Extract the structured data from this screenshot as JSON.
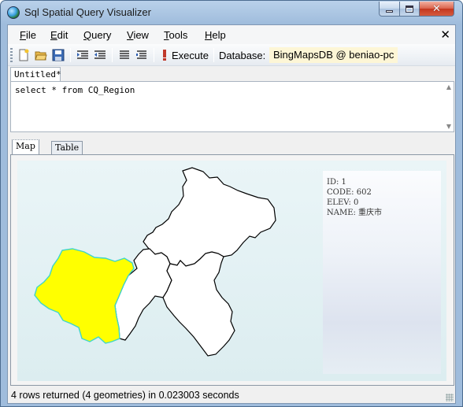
{
  "window": {
    "title": "Sql Spatial Query Visualizer"
  },
  "menu": {
    "file": {
      "u": "F",
      "rest": "ile"
    },
    "edit": {
      "u": "E",
      "rest": "dit"
    },
    "query": {
      "u": "Q",
      "rest": "uery"
    },
    "view": {
      "u": "V",
      "rest": "iew"
    },
    "tools": {
      "u": "T",
      "rest": "ools"
    },
    "help": {
      "u": "H",
      "rest": "elp"
    }
  },
  "toolbar": {
    "execute_label": "Execute",
    "database_label": "Database:",
    "database_value": "BingMapsDB @ beniao-pc"
  },
  "document": {
    "tab_label": "Untitled*",
    "query_text": "select * from CQ_Region"
  },
  "result_tabs": {
    "map_label": "Map",
    "table_label": "Table"
  },
  "info": {
    "id": "ID: 1",
    "code": "CODE: 602",
    "elev": "ELEV: 0",
    "name": "NAME: 重庆市"
  },
  "status": {
    "text": "4 rows returned (4 geometries) in 0.023003 seconds"
  },
  "colors": {
    "selected_region_fill": "#ffff00",
    "selected_region_stroke": "#3fd6c8",
    "region_fill": "#ffffff",
    "region_stroke": "#000000"
  }
}
